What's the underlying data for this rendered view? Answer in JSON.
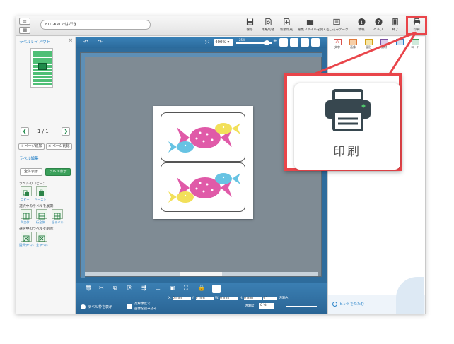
{
  "topbar": {
    "menu_icon": "hamburger-icon",
    "view_icon": "grid-icon",
    "path": "EDT-KPL2/はがき",
    "tools": [
      {
        "icon": "save-icon",
        "label": "保存"
      },
      {
        "icon": "print-preview-icon",
        "label": "用紙切替"
      },
      {
        "icon": "new-file-icon",
        "label": "新規作成"
      },
      {
        "icon": "open-file-icon",
        "label": "編集ファイルを開く"
      },
      {
        "icon": "data-import-icon",
        "label": "差し込みデータ"
      },
      {
        "icon": "info-icon",
        "label": "情報"
      },
      {
        "icon": "help-icon",
        "label": "ヘルプ"
      },
      {
        "icon": "exit-icon",
        "label": "終了"
      },
      {
        "icon": "printer-icon",
        "label": "印刷"
      }
    ]
  },
  "sidebar": {
    "title": "ラベルレイアウト",
    "close": "×",
    "page_indicator": "1 / 1",
    "add_page": "+ ページ追加",
    "delete_page": "× ページ削除",
    "label_edit_title": "ラベル編集",
    "show_all": "全体表示",
    "show_label": "ラベル表示",
    "copy_title": "ラベルのコピー：",
    "copy": "コピー",
    "paste": "ペースト",
    "select_title_1": "選択中のラベルを展開：",
    "expand_labels": [
      "列全体",
      "行全体",
      "全ラベル"
    ],
    "select_title_2": "選択中のラベルを削除：",
    "delete_labels": [
      "選択ラベル",
      "全ラベル"
    ]
  },
  "canvas": {
    "zoom": "400%",
    "zoom_scale_label": "25%",
    "bottom": {
      "show_frame": "ラベル枠を表示",
      "hi_speed_1": "高解像度で",
      "hi_speed_2": "画像を読み込み",
      "x_label": "X:",
      "x_value": "0 mm",
      "y_label": "Y:",
      "y_value": "0 mm",
      "w_label": "W:",
      "w_value": "0 mm",
      "h_label": "H:",
      "h_value": "0 mm",
      "rotate": "0°",
      "transparency_label": "透明色",
      "opacity_label": "透明度",
      "opacity_value": "0 %"
    }
  },
  "right_panel": {
    "tools": [
      {
        "label": "文字",
        "color": "#d9534f"
      },
      {
        "label": "画像",
        "color": "#e07a3a"
      },
      {
        "label": "図形",
        "color": "#d4a017"
      },
      {
        "label": "素材",
        "color": "#7b4fa0"
      },
      {
        "label": "",
        "color": "#2b84c9"
      },
      {
        "label": "コード",
        "color": "#3aa05a"
      }
    ],
    "hint": "ヒントをたたむ"
  },
  "callout": {
    "label": "印刷"
  },
  "colors": {
    "accent_blue": "#2e6c9c",
    "highlight_red": "#e9454a",
    "candy_pink": "#e05aa8",
    "candy_blue": "#67c3e3",
    "candy_yellow": "#f2e05a",
    "green_button": "#3aa05a"
  }
}
